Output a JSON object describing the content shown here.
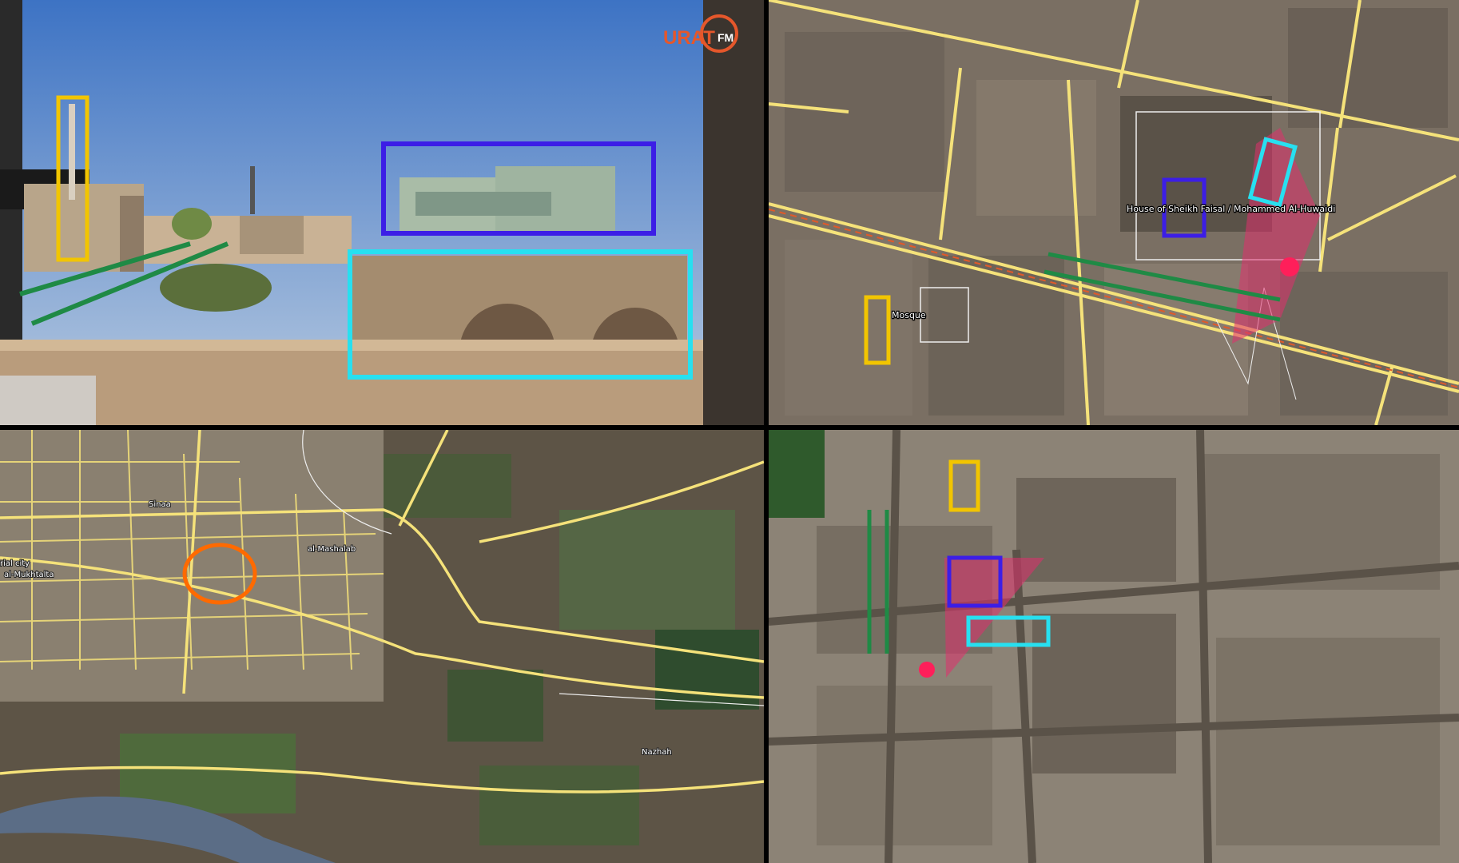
{
  "photo": {
    "logo_text": "URAT",
    "logo_suffix": "FM"
  },
  "map_top_right": {
    "labels": {
      "house": "House of Sheikh Faisal / Mohammed Al-Huwaidi",
      "mosque": "Mosque"
    }
  },
  "map_bottom_left": {
    "labels": {
      "sinaa": "Sinaa",
      "industrial_city": "rial city",
      "mukhtalta": "al-Mukhtalta",
      "mashalab": "al-Mashalab",
      "nazhah": "Nazhah"
    }
  },
  "colors": {
    "minaret_box": "#f2c500",
    "building_box": "#3c1ee6",
    "arch_box": "#27e0f0",
    "line_of_sight": "#1f8a45",
    "camera_marker": "#ff1f5a",
    "view_cone": "#e0306e",
    "location_circle": "#ff6a00",
    "road": "#f5e27a"
  }
}
